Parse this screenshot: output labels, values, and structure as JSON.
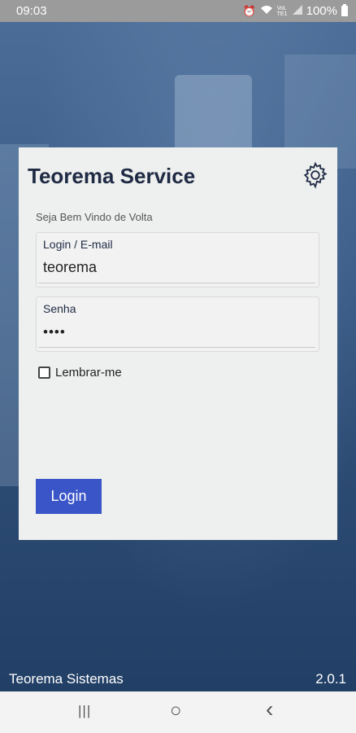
{
  "status_bar": {
    "time": "09:03",
    "icons": [
      "alarm-icon",
      "wifi-icon",
      "volte-icon",
      "signal-icon",
      "battery-icon"
    ],
    "volte_label": "VoLTE1",
    "battery": "100%"
  },
  "login": {
    "title": "Teorema Service",
    "welcome": "Seja Bem Vindo de Volta",
    "login_label": "Login / E-mail",
    "login_value": "teorema",
    "password_label": "Senha",
    "password_value": "••••",
    "remember_label": "Lembrar-me",
    "remember_checked": false,
    "button_label": "Login",
    "button_color": "#3a55c7"
  },
  "footer": {
    "company": "Teorema Sistemas",
    "version": "2.0.1"
  },
  "nav_bar": {
    "recents": "|||",
    "home": "○",
    "back": "‹"
  }
}
